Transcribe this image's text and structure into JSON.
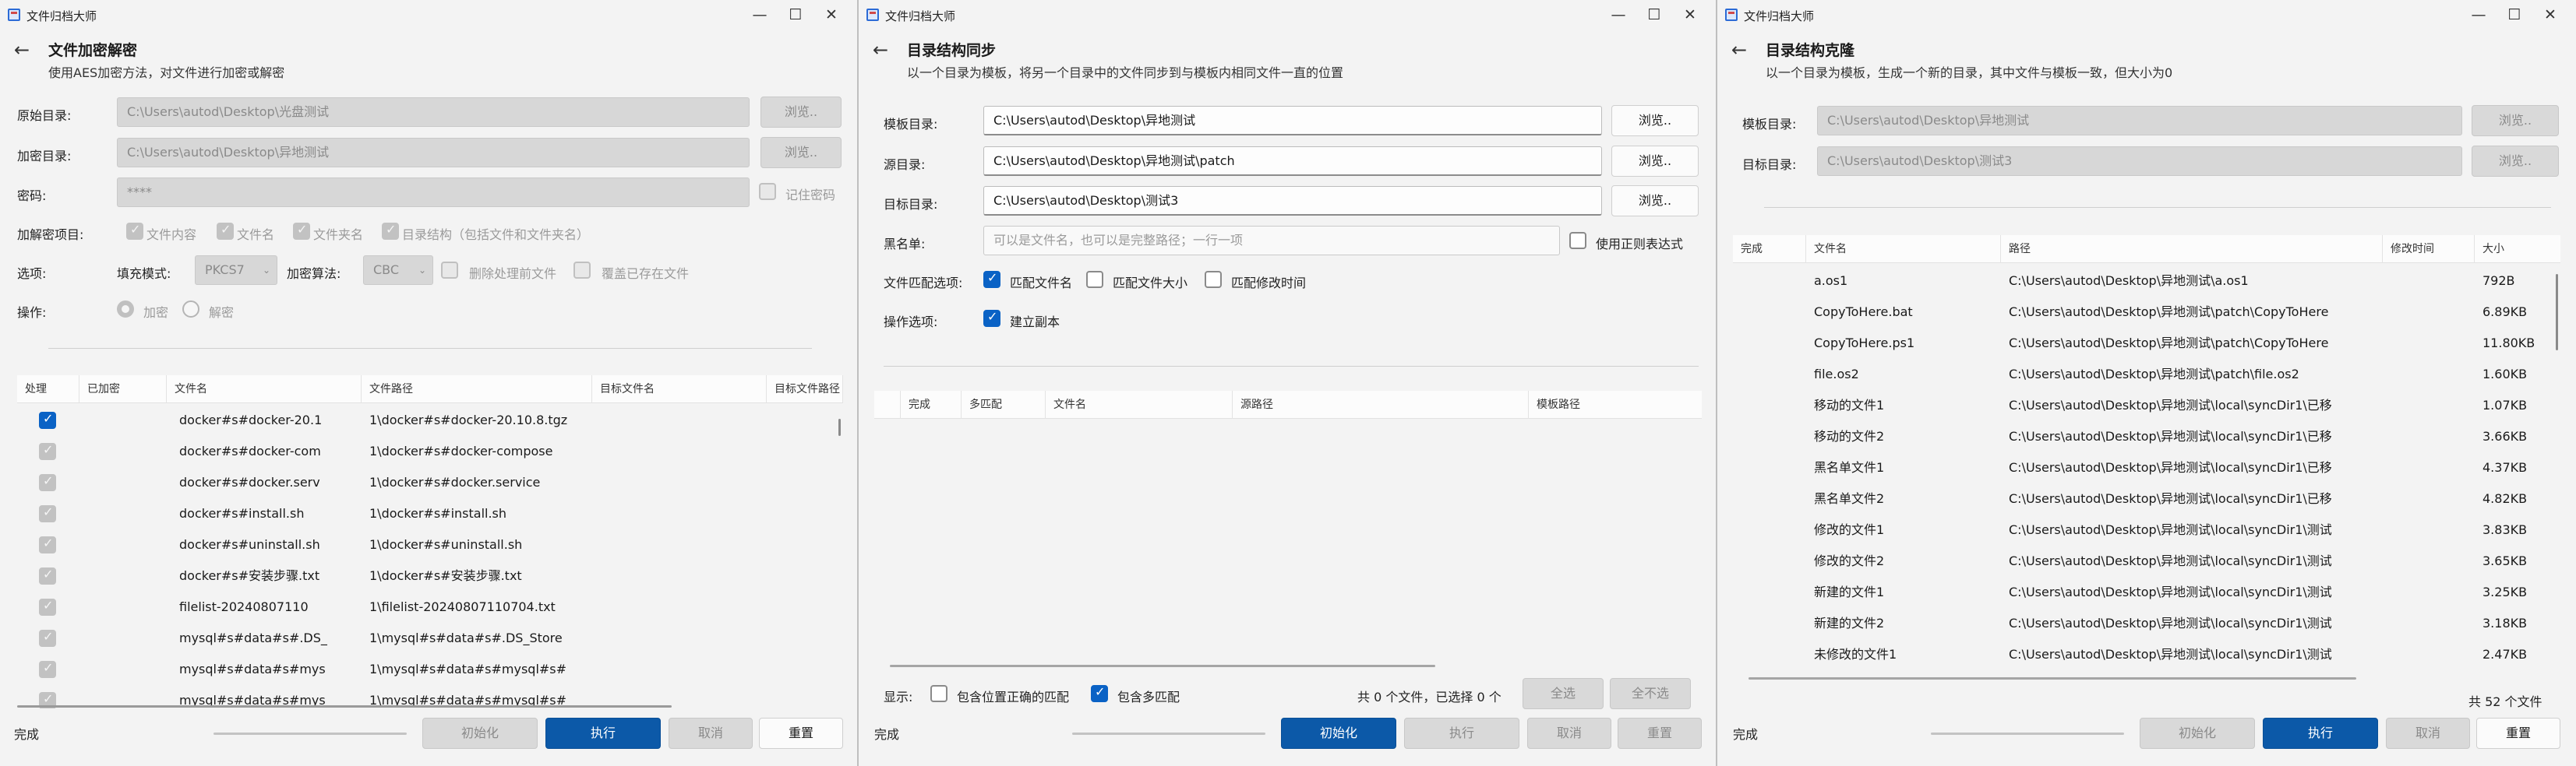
{
  "app_title": "文件归档大师",
  "w1": {
    "title": "文件加密解密",
    "subtitle": "使用AES加密方法，对文件进行加密或解密",
    "src_label": "原始目录:",
    "src_value": "C:\\Users\\autod\\Desktop\\光盘测试",
    "browse": "浏览..",
    "enc_label": "加密目录:",
    "enc_value": "C:\\Users\\autod\\Desktop\\异地测试",
    "pwd_label": "密码:",
    "pwd_value": "****",
    "remember": "记住密码",
    "items_label": "加解密项目:",
    "items": [
      "文件内容",
      "文件名",
      "文件夹名",
      "目录结构（包括文件和文件夹名）"
    ],
    "opt_label": "选项:",
    "pad_label": "填充模式:",
    "pad_value": "PKCS7",
    "alg_label": "加密算法:",
    "alg_value": "CBC",
    "del_label": "删除处理前文件",
    "over_label": "覆盖已存在文件",
    "op_label": "操作:",
    "enc_radio": "加密",
    "dec_radio": "解密",
    "headers": [
      "处理",
      "已加密",
      "文件名",
      "文件路径",
      "目标文件名",
      "目标文件路径"
    ],
    "rows": [
      {
        "name": "docker#s#docker-20.1",
        "path": "1\\docker#s#docker-20.10.8.tgz",
        "active": true
      },
      {
        "name": "docker#s#docker-com",
        "path": "1\\docker#s#docker-compose"
      },
      {
        "name": "docker#s#docker.serv",
        "path": "1\\docker#s#docker.service"
      },
      {
        "name": "docker#s#install.sh",
        "path": "1\\docker#s#install.sh"
      },
      {
        "name": "docker#s#uninstall.sh",
        "path": "1\\docker#s#uninstall.sh"
      },
      {
        "name": "docker#s#安装步骤.txt",
        "path": "1\\docker#s#安装步骤.txt"
      },
      {
        "name": "filelist-20240807110",
        "path": "1\\filelist-20240807110704.txt"
      },
      {
        "name": "mysql#s#data#s#.DS_",
        "path": "1\\mysql#s#data#s#.DS_Store"
      },
      {
        "name": "mysql#s#data#s#mys",
        "path": "1\\mysql#s#data#s#mysql#s#"
      },
      {
        "name": "mysql#s#data#s#mys",
        "path": "1\\mysql#s#data#s#mysql#s#"
      }
    ],
    "status": "完成",
    "init": "初始化",
    "exec": "执行",
    "cancel": "取消",
    "reset": "重置"
  },
  "w2": {
    "title": "目录结构同步",
    "subtitle": "以一个目录为模板，将另一个目录中的文件同步到与模板内相同文件一直的位置",
    "tpl_label": "模板目录:",
    "tpl_value": "C:\\Users\\autod\\Desktop\\异地测试",
    "browse": "浏览..",
    "src_label": "源目录:",
    "src_value": "C:\\Users\\autod\\Desktop\\异地测试\\patch",
    "dst_label": "目标目录:",
    "dst_value": "C:\\Users\\autod\\Desktop\\测试3",
    "black_label": "黑名单:",
    "black_ph": "可以是文件名，也可以是完整路径；一行一项",
    "regex": "使用正则表达式",
    "match_label": "文件匹配选项:",
    "match_name": "匹配文件名",
    "match_size": "匹配文件大小",
    "match_time": "匹配修改时间",
    "op_label": "操作选项:",
    "copy": "建立副本",
    "headers": [
      "完成",
      "多匹配",
      "文件名",
      "源路径",
      "模板路径"
    ],
    "show_label": "显示:",
    "incl_pos": "包含位置正确的匹配",
    "incl_multi": "包含多匹配",
    "count": "共 0 个文件，已选择 0 个",
    "select_all": "全选",
    "select_none": "全不选",
    "status": "完成",
    "init": "初始化",
    "exec": "执行",
    "cancel": "取消",
    "reset": "重置"
  },
  "w3": {
    "title": "目录结构克隆",
    "subtitle": "以一个目录为模板，生成一个新的目录，其中文件与模板一致，但大小为0",
    "tpl_label": "模板目录:",
    "tpl_value": "C:\\Users\\autod\\Desktop\\异地测试",
    "browse": "浏览..",
    "dst_label": "目标目录:",
    "dst_value": "C:\\Users\\autod\\Desktop\\测试3",
    "headers": [
      "完成",
      "文件名",
      "路径",
      "修改时间",
      "大小"
    ],
    "rows": [
      {
        "name": "a.os1",
        "path": "C:\\Users\\autod\\Desktop\\异地测试\\a.os1",
        "size": "792B"
      },
      {
        "name": "CopyToHere.bat",
        "path": "C:\\Users\\autod\\Desktop\\异地测试\\patch\\CopyToHere",
        "size": "6.89KB"
      },
      {
        "name": "CopyToHere.ps1",
        "path": "C:\\Users\\autod\\Desktop\\异地测试\\patch\\CopyToHere",
        "size": "11.80KB"
      },
      {
        "name": "file.os2",
        "path": "C:\\Users\\autod\\Desktop\\异地测试\\patch\\file.os2",
        "size": "1.60KB"
      },
      {
        "name": "移动的文件1",
        "path": "C:\\Users\\autod\\Desktop\\异地测试\\local\\syncDir1\\已移",
        "size": "1.07KB"
      },
      {
        "name": "移动的文件2",
        "path": "C:\\Users\\autod\\Desktop\\异地测试\\local\\syncDir1\\已移",
        "size": "3.66KB"
      },
      {
        "name": "黑名单文件1",
        "path": "C:\\Users\\autod\\Desktop\\异地测试\\local\\syncDir1\\已移",
        "size": "4.37KB"
      },
      {
        "name": "黑名单文件2",
        "path": "C:\\Users\\autod\\Desktop\\异地测试\\local\\syncDir1\\已移",
        "size": "4.82KB"
      },
      {
        "name": "修改的文件1",
        "path": "C:\\Users\\autod\\Desktop\\异地测试\\local\\syncDir1\\测试",
        "size": "3.83KB"
      },
      {
        "name": "修改的文件2",
        "path": "C:\\Users\\autod\\Desktop\\异地测试\\local\\syncDir1\\测试",
        "size": "3.65KB"
      },
      {
        "name": "新建的文件1",
        "path": "C:\\Users\\autod\\Desktop\\异地测试\\local\\syncDir1\\测试",
        "size": "3.25KB"
      },
      {
        "name": "新建的文件2",
        "path": "C:\\Users\\autod\\Desktop\\异地测试\\local\\syncDir1\\测试",
        "size": "3.18KB"
      },
      {
        "name": "未修改的文件1",
        "path": "C:\\Users\\autod\\Desktop\\异地测试\\local\\syncDir1\\测试",
        "size": "2.47KB"
      }
    ],
    "count": "共 52 个文件",
    "status": "完成",
    "init": "初始化",
    "exec": "执行",
    "cancel": "取消",
    "reset": "重置"
  }
}
